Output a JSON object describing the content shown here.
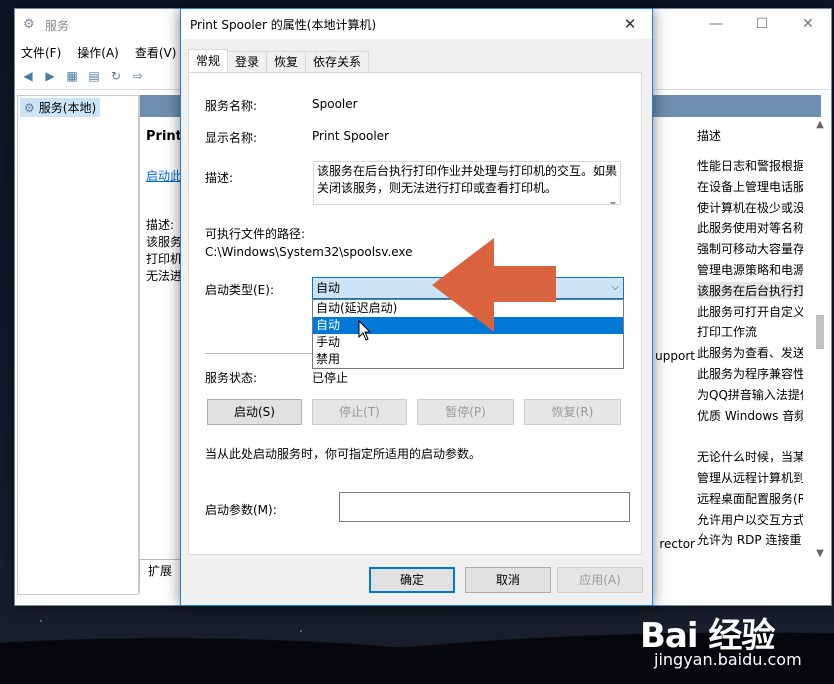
{
  "services_window": {
    "title": "服务",
    "menu": [
      "文件(F)",
      "操作(A)",
      "查看(V)"
    ],
    "tree_item": "服务(本地)",
    "mid_header_partial": "服",
    "mid_title_partial": "Print",
    "mid_link_partial": "启动此",
    "mid_desc_lines": [
      "描述:",
      "该服务",
      "打印机",
      "无法进"
    ],
    "mid_tab_partial": "扩展",
    "column_header": "描述",
    "rows": [
      "性能日志和警报根据",
      "在设备上管理电话服",
      "使计算机在极少或没",
      "此服务使用对等名称",
      "强制可移动大容量存",
      "管理电源策略和电源",
      "该服务在后台执行打",
      "此服务可打开自定义",
      "打印工作流",
      "此服务为查看、发送",
      "此服务为程序兼容性",
      "为QQ拼音输入法提供",
      "优质 Windows 音频",
      "",
      "无论什么时候，当某",
      "管理从远程计算机到",
      "远程桌面配置服务(R",
      "允许用户以交互方式",
      "允许为 RDP 连接重"
    ],
    "side_partials": {
      "upport": "upport",
      "rector": "rector"
    },
    "selected_row_index": 6
  },
  "dialog": {
    "title": "Print Spooler 的属性(本地计算机)",
    "tabs": [
      "常规",
      "登录",
      "恢复",
      "依存关系"
    ],
    "active_tab": 0,
    "service_name_label": "服务名称:",
    "service_name_value": "Spooler",
    "display_name_label": "显示名称:",
    "display_name_value": "Print Spooler",
    "description_label": "描述:",
    "description_value": "该服务在后台执行打印作业并处理与打印机的交互。如果关闭该服务，则无法进行打印或查看打印机。",
    "exe_path_label": "可执行文件的路径:",
    "exe_path_value": "C:\\Windows\\System32\\spoolsv.exe",
    "startup_type_label": "启动类型(E):",
    "startup_type_value": "自动",
    "startup_options": [
      "自动(延迟启动)",
      "自动",
      "手动",
      "禁用"
    ],
    "highlighted_option_index": 1,
    "status_label": "服务状态:",
    "status_value": "已停止",
    "buttons": {
      "start": "启动(S)",
      "stop": "停止(T)",
      "pause": "暂停(P)",
      "resume": "恢复(R)"
    },
    "hint": "当从此处启动服务时，你可指定所适用的启动参数。",
    "param_label": "启动参数(M):",
    "param_value": "",
    "footer": {
      "ok": "确定",
      "cancel": "取消",
      "apply": "应用(A)"
    }
  },
  "annotation": {
    "arrow_color": "#d9623f"
  },
  "watermark": {
    "main": "Bai 经验",
    "sub": "jingyan.baidu.com"
  },
  "colors": {
    "accent": "#0078d7",
    "selection": "#cce4f7"
  }
}
